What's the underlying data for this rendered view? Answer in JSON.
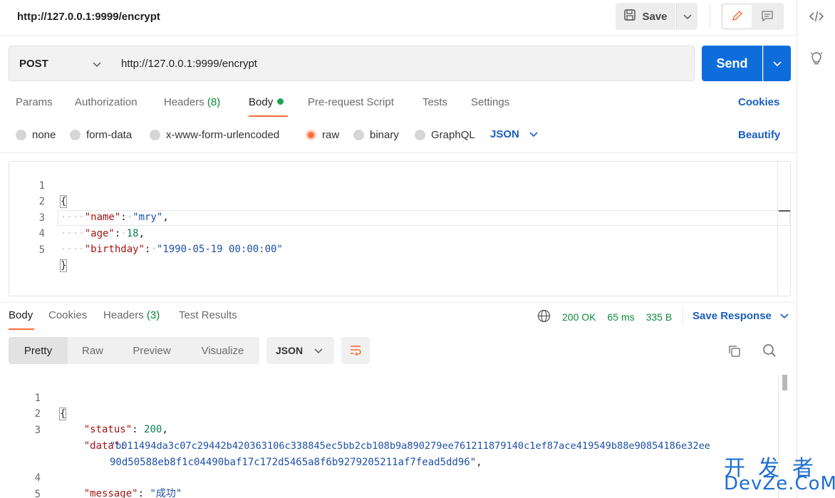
{
  "request": {
    "name": "http://127.0.0.1:9999/encrypt",
    "method": "POST",
    "url": "http://127.0.0.1:9999/encrypt",
    "save_label": "Save",
    "send_label": "Send"
  },
  "request_tabs": {
    "params": "Params",
    "authorization": "Authorization",
    "headers": "Headers",
    "headers_count": "(8)",
    "body": "Body",
    "pre_request": "Pre-request Script",
    "tests": "Tests",
    "settings": "Settings",
    "cookies": "Cookies"
  },
  "body_types": {
    "none": "none",
    "form_data": "form-data",
    "urlencoded": "x-www-form-urlencoded",
    "raw": "raw",
    "binary": "binary",
    "graphql": "GraphQL",
    "format": "JSON",
    "beautify": "Beautify",
    "selected": "raw"
  },
  "request_body": {
    "line_numbers": [
      "1",
      "2",
      "3",
      "4",
      "5"
    ],
    "open_brace": "{",
    "close_brace": "}",
    "name_key": "\"name\"",
    "name_value": "\"mry\"",
    "age_key": "\"age\"",
    "age_value": "18",
    "birthday_key": "\"birthday\"",
    "birthday_value": "\"1990-05-19 00:00:00\""
  },
  "response_tabs": {
    "body": "Body",
    "cookies": "Cookies",
    "headers": "Headers",
    "headers_count": "(3)",
    "test_results": "Test Results"
  },
  "response_status": {
    "status": "200 OK",
    "time": "65 ms",
    "size": "335 B",
    "save_response": "Save Response"
  },
  "response_view": {
    "pretty": "Pretty",
    "raw": "Raw",
    "preview": "Preview",
    "visualize": "Visualize",
    "format": "JSON"
  },
  "response_body": {
    "line_numbers": [
      "1",
      "2",
      "3",
      "4",
      "5"
    ],
    "open_brace": "{",
    "close_brace": "}",
    "status_key": "\"status\"",
    "status_value": "200",
    "data_key": "\"data\"",
    "data_value_line1": "\"b011494da3c07c29442b420363106c338845ec5bb2cb108b9a890279ee761211879140c1ef87ace419549b88e90854186e32ee",
    "data_value_line2": "90d50588eb8f1c04490baf17c172d5465a8f6b9279205211af7fead5dd96\"",
    "message_key": "\"message\"",
    "message_value": "\"成功\""
  },
  "watermark": {
    "top": "开发者",
    "bottom": "DevZe.CoM"
  },
  "colors": {
    "accent_orange": "#ff6c37",
    "send_blue": "#0f6ddb",
    "link_blue": "#1a5ec2",
    "status_green": "#0b8a3b"
  }
}
